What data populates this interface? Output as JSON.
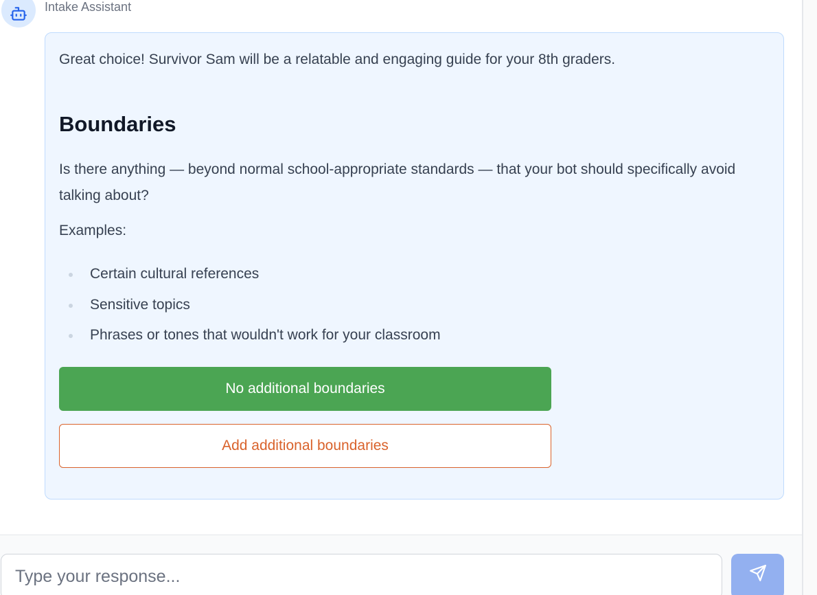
{
  "header": {
    "sender_name": "Intake Assistant",
    "avatar_icon": "robot-icon"
  },
  "message": {
    "intro": "Great choice! Survivor Sam will be a relatable and engaging guide for your 8th graders.",
    "heading": "Boundaries",
    "question": "Is there anything — beyond normal school-appropriate standards — that your bot should specifically avoid talking about?",
    "examples_label": "Examples:",
    "examples": [
      "Certain cultural references",
      "Sensitive topics",
      "Phrases or tones that wouldn't work for your classroom"
    ]
  },
  "options": {
    "primary_label": "No additional boundaries",
    "secondary_label": "Add additional boundaries"
  },
  "composer": {
    "placeholder": "Type your response...",
    "value": "",
    "send_icon": "send-icon"
  },
  "colors": {
    "bubble_bg": "#eff6ff",
    "primary": "#4ba553",
    "secondary": "#d9622b",
    "send": "#93b0f0",
    "avatar_bg": "#dbeafe"
  }
}
